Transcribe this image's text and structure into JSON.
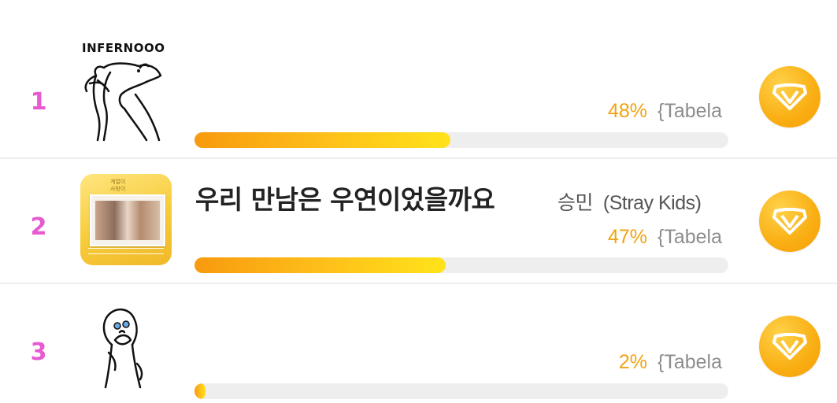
{
  "rows": [
    {
      "rank": "1",
      "art_caption": "INFERNOOO",
      "art_icon": "meme-drawing-icon",
      "title": "",
      "artist": "",
      "percent_label": "48%",
      "percent": 48,
      "tabela_label": "{Tabela",
      "badge_icon": "heart-diamond-icon"
    },
    {
      "rank": "2",
      "art_icon": "album-cover",
      "cover_top_text": "계절이\n사랑이",
      "title": "우리 만남은 우연이었을까요",
      "artist": "승민  (Stray Kids)",
      "percent_label": "47%",
      "percent": 47,
      "tabela_label": "{Tabela",
      "badge_icon": "heart-diamond-icon"
    },
    {
      "rank": "3",
      "art_icon": "shy-meme-drawing-icon",
      "title": "",
      "artist": "",
      "percent_label": "2%",
      "percent": 2,
      "tabela_label": "{Tabela",
      "badge_icon": "heart-diamond-icon"
    }
  ],
  "colors": {
    "rank": "#e75ad0",
    "percent": "#f2a20c",
    "bar_start": "#f79a0f",
    "bar_end": "#ffe31a",
    "badge": "#f9ae12"
  }
}
